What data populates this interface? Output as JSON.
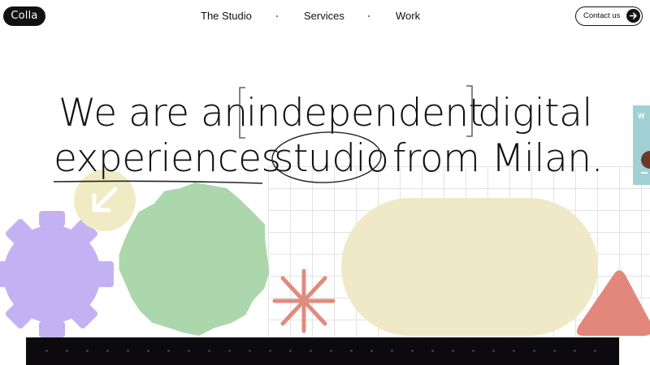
{
  "header": {
    "logo_text": "Colla",
    "nav": [
      {
        "label": "The Studio"
      },
      {
        "label": "Services"
      },
      {
        "label": "Work"
      }
    ],
    "contact_label": "Contact us",
    "contact_icon": "arrow-right-icon"
  },
  "hero": {
    "line1_before": "We are an",
    "line1_bracketed": "independent",
    "line1_after": "digital",
    "line2_underlined": "experiences",
    "line2_circled": "studio",
    "line2_after": "from Milan."
  },
  "side_card": {
    "label": "W"
  },
  "colors": {
    "purple": "#c3b2f3",
    "green": "#acd6ac",
    "pale_yellow": "#efe9c7",
    "badge_yellow": "#f0ebc5",
    "coral": "#e2877b",
    "teal": "#9fd0d4",
    "black": "#0c0a0e"
  },
  "icons": {
    "badge": "arrow-down-left-icon",
    "star": "asterisk-icon"
  }
}
